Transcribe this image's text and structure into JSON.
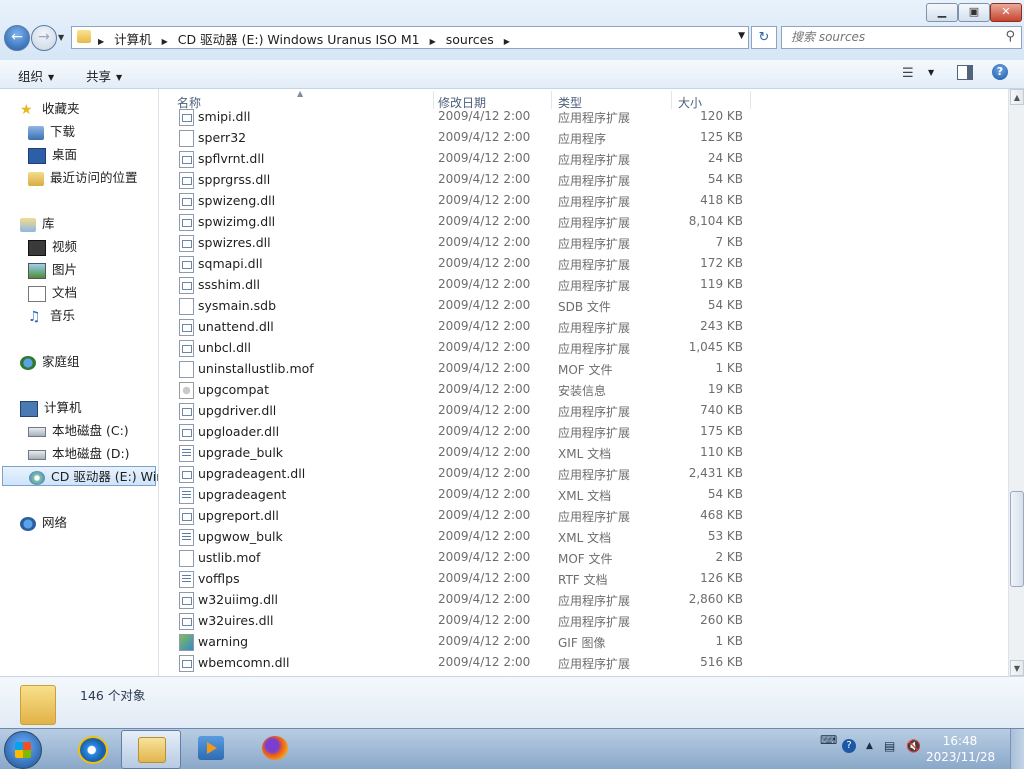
{
  "window": {
    "min_label": "▁",
    "max_label": "▣",
    "close_label": "✕"
  },
  "address": {
    "crumbs": [
      "计算机",
      "CD 驱动器 (E:) Windows Uranus ISO M1",
      "sources"
    ]
  },
  "search": {
    "placeholder": "搜索 sources"
  },
  "toolbar": {
    "organize": "组织",
    "share": "共享"
  },
  "navpane": {
    "favorites": "收藏夹",
    "downloads": "下载",
    "desktop": "桌面",
    "recent": "最近访问的位置",
    "libraries": "库",
    "videos": "视频",
    "pictures": "图片",
    "documents": "文档",
    "music": "音乐",
    "homegroup": "家庭组",
    "computer": "计算机",
    "drive_c": "本地磁盘 (C:)",
    "drive_d": "本地磁盘 (D:)",
    "drive_e": "CD 驱动器 (E:) Win",
    "network": "网络"
  },
  "columns": {
    "name": "名称",
    "date": "修改日期",
    "type": "类型",
    "size": "大小"
  },
  "files": [
    {
      "name": "smipi.dll",
      "date": "2009/4/12 2:00",
      "type": "应用程序扩展",
      "size": "120 KB",
      "icon": "dll"
    },
    {
      "name": "sperr32",
      "date": "2009/4/12 2:00",
      "type": "应用程序",
      "size": "125 KB",
      "icon": "exe"
    },
    {
      "name": "spflvrnt.dll",
      "date": "2009/4/12 2:00",
      "type": "应用程序扩展",
      "size": "24 KB",
      "icon": "dll"
    },
    {
      "name": "spprgrss.dll",
      "date": "2009/4/12 2:00",
      "type": "应用程序扩展",
      "size": "54 KB",
      "icon": "dll"
    },
    {
      "name": "spwizeng.dll",
      "date": "2009/4/12 2:00",
      "type": "应用程序扩展",
      "size": "418 KB",
      "icon": "dll"
    },
    {
      "name": "spwizimg.dll",
      "date": "2009/4/12 2:00",
      "type": "应用程序扩展",
      "size": "8,104 KB",
      "icon": "dll"
    },
    {
      "name": "spwizres.dll",
      "date": "2009/4/12 2:00",
      "type": "应用程序扩展",
      "size": "7 KB",
      "icon": "dll"
    },
    {
      "name": "sqmapi.dll",
      "date": "2009/4/12 2:00",
      "type": "应用程序扩展",
      "size": "172 KB",
      "icon": "dll"
    },
    {
      "name": "ssshim.dll",
      "date": "2009/4/12 2:00",
      "type": "应用程序扩展",
      "size": "119 KB",
      "icon": "dll"
    },
    {
      "name": "sysmain.sdb",
      "date": "2009/4/12 2:00",
      "type": "SDB 文件",
      "size": "54 KB",
      "icon": "blank"
    },
    {
      "name": "unattend.dll",
      "date": "2009/4/12 2:00",
      "type": "应用程序扩展",
      "size": "243 KB",
      "icon": "dll"
    },
    {
      "name": "unbcl.dll",
      "date": "2009/4/12 2:00",
      "type": "应用程序扩展",
      "size": "1,045 KB",
      "icon": "dll"
    },
    {
      "name": "uninstallustlib.mof",
      "date": "2009/4/12 2:00",
      "type": "MOF 文件",
      "size": "1 KB",
      "icon": "blank"
    },
    {
      "name": "upgcompat",
      "date": "2009/4/12 2:00",
      "type": "安装信息",
      "size": "19 KB",
      "icon": "inf"
    },
    {
      "name": "upgdriver.dll",
      "date": "2009/4/12 2:00",
      "type": "应用程序扩展",
      "size": "740 KB",
      "icon": "dll"
    },
    {
      "name": "upgloader.dll",
      "date": "2009/4/12 2:00",
      "type": "应用程序扩展",
      "size": "175 KB",
      "icon": "dll"
    },
    {
      "name": "upgrade_bulk",
      "date": "2009/4/12 2:00",
      "type": "XML 文档",
      "size": "110 KB",
      "icon": "xml"
    },
    {
      "name": "upgradeagent.dll",
      "date": "2009/4/12 2:00",
      "type": "应用程序扩展",
      "size": "2,431 KB",
      "icon": "dll"
    },
    {
      "name": "upgradeagent",
      "date": "2009/4/12 2:00",
      "type": "XML 文档",
      "size": "54 KB",
      "icon": "xml"
    },
    {
      "name": "upgreport.dll",
      "date": "2009/4/12 2:00",
      "type": "应用程序扩展",
      "size": "468 KB",
      "icon": "dll"
    },
    {
      "name": "upgwow_bulk",
      "date": "2009/4/12 2:00",
      "type": "XML 文档",
      "size": "53 KB",
      "icon": "xml"
    },
    {
      "name": "ustlib.mof",
      "date": "2009/4/12 2:00",
      "type": "MOF 文件",
      "size": "2 KB",
      "icon": "blank"
    },
    {
      "name": "vofflps",
      "date": "2009/4/12 2:00",
      "type": "RTF 文档",
      "size": "126 KB",
      "icon": "xml"
    },
    {
      "name": "w32uiimg.dll",
      "date": "2009/4/12 2:00",
      "type": "应用程序扩展",
      "size": "2,860 KB",
      "icon": "dll"
    },
    {
      "name": "w32uires.dll",
      "date": "2009/4/12 2:00",
      "type": "应用程序扩展",
      "size": "260 KB",
      "icon": "dll"
    },
    {
      "name": "warning",
      "date": "2009/4/12 2:00",
      "type": "GIF 图像",
      "size": "1 KB",
      "icon": "gif"
    },
    {
      "name": "wbemcomn.dll",
      "date": "2009/4/12 2:00",
      "type": "应用程序扩展",
      "size": "516 KB",
      "icon": "dll"
    }
  ],
  "details": {
    "count": "146 个对象"
  },
  "taskbar": {
    "time": "16:48",
    "date": "2023/11/28"
  },
  "colors": {
    "accent": "#1f5ca8",
    "selection": "#cfe3fa"
  }
}
